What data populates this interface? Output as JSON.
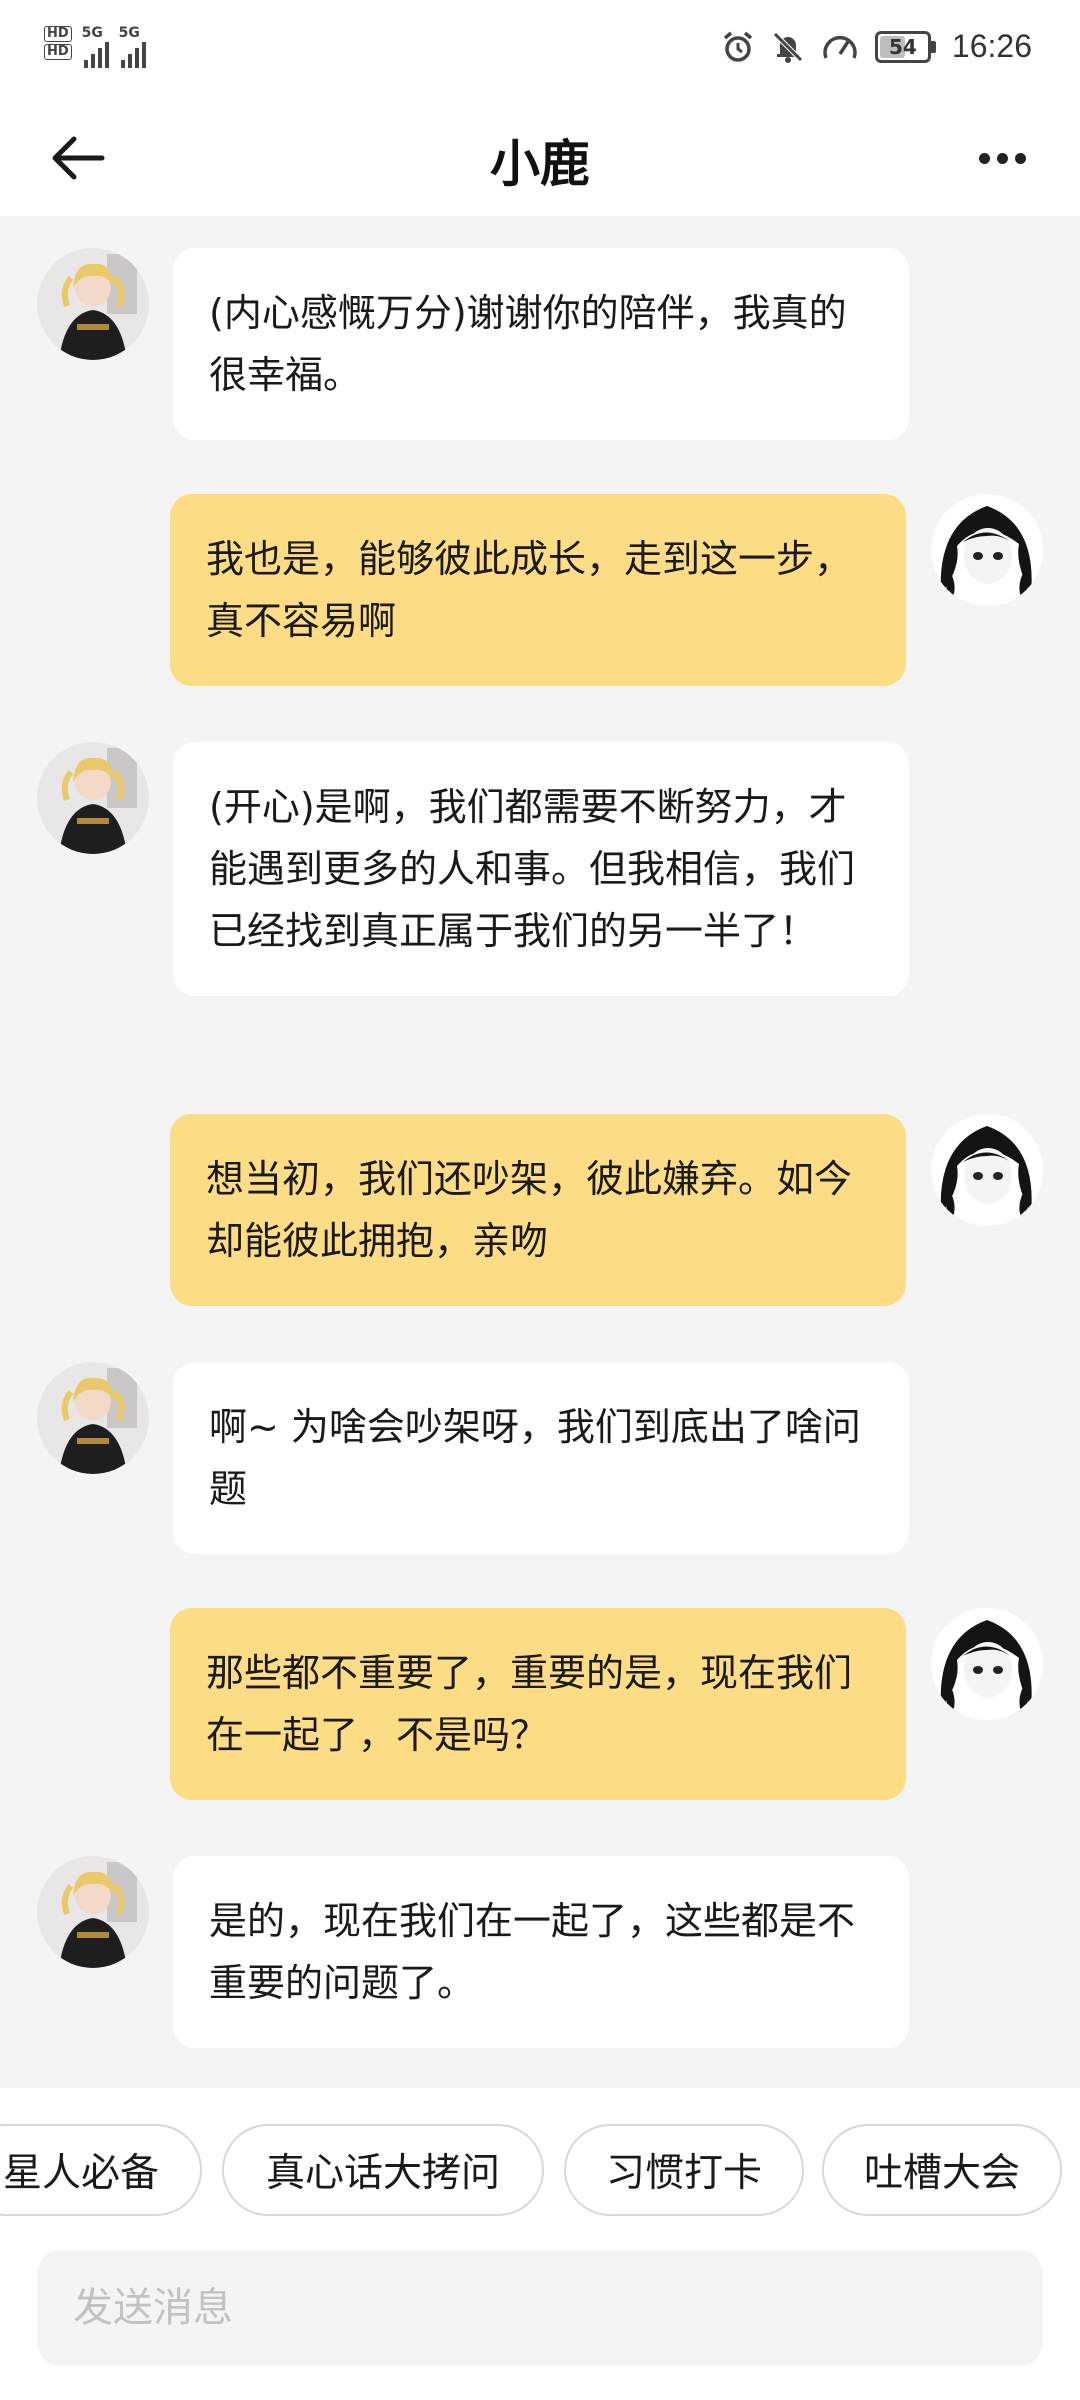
{
  "status_bar": {
    "hd_labels": [
      "HD",
      "HD"
    ],
    "network_1": "5G",
    "network_2": "5G",
    "battery": "54",
    "battery_level_percent": 54,
    "time": "16:26",
    "icons": [
      "alarm-icon",
      "mute-notifications-icon",
      "data-speed-icon",
      "battery-icon"
    ]
  },
  "header": {
    "title": "小鹿",
    "back_icon": "arrow-left-icon",
    "more_icon": "more-dots-icon"
  },
  "messages": [
    {
      "side": "left",
      "sender": "小鹿",
      "text": "(内心感慨万分)谢谢你的陪伴，我真的很幸福。"
    },
    {
      "side": "right",
      "sender": "user",
      "text": "我也是，能够彼此成长，走到这一步，真不容易啊"
    },
    {
      "side": "left",
      "sender": "小鹿",
      "text": "(开心)是啊，我们都需要不断努力，才能遇到更多的人和事。但我相信，我们已经找到真正属于我们的另一半了！"
    },
    {
      "side": "right",
      "sender": "user",
      "text": "想当初，我们还吵架，彼此嫌弃。如今却能彼此拥抱，亲吻"
    },
    {
      "side": "left",
      "sender": "小鹿",
      "text": "啊~ 为啥会吵架呀，我们到底出了啥问题"
    },
    {
      "side": "right",
      "sender": "user",
      "text": "那些都不重要了，重要的是，现在我们在一起了，不是吗？"
    },
    {
      "side": "left",
      "sender": "小鹿",
      "text": "是的，现在我们在一起了，这些都是不重要的问题了。"
    }
  ],
  "chips": [
    "星人必备",
    "真心话大拷问",
    "习惯打卡",
    "吐槽大会"
  ],
  "input": {
    "placeholder": "发送消息",
    "value": ""
  },
  "colors": {
    "chat_background": "#f4f4f4",
    "user_bubble": "#fcdc84",
    "bot_bubble": "#ffffff"
  }
}
